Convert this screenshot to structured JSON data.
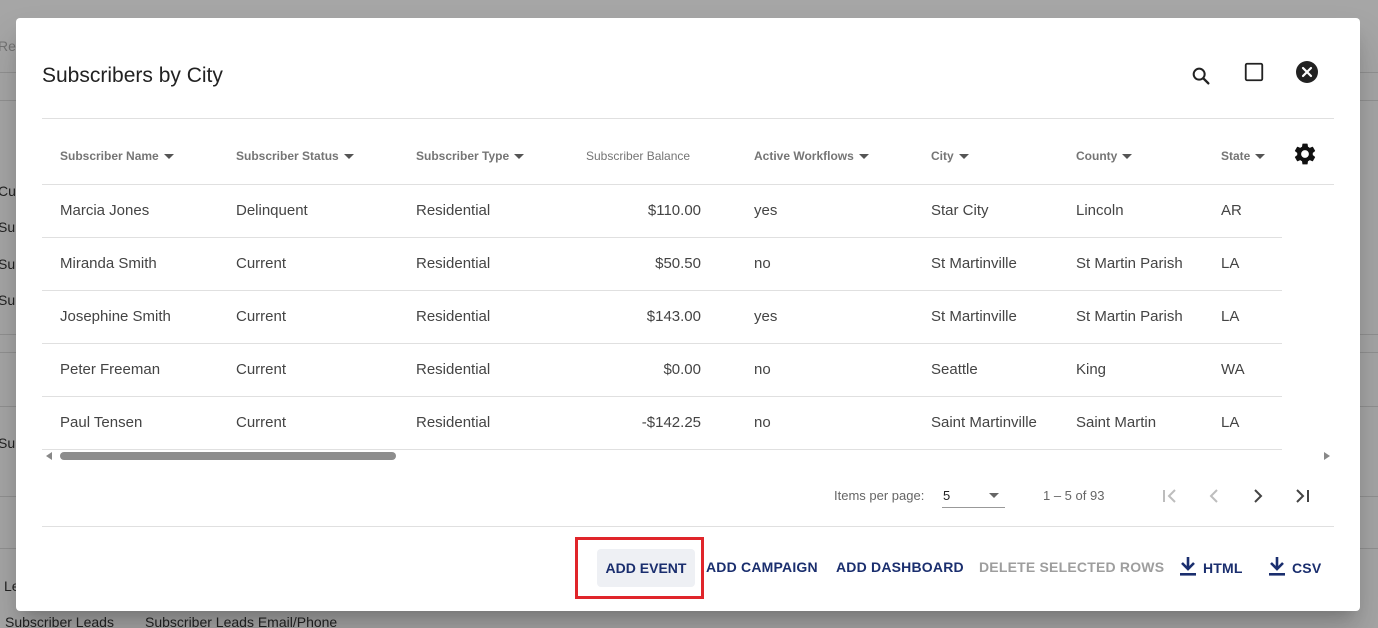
{
  "background": {
    "text_top_left": "Ref",
    "side_fragments": [
      "Cur",
      "Sub",
      "Sub",
      "Sub",
      "Sub",
      "Le"
    ],
    "bottom_tabs": [
      "Subscriber Leads",
      "Subscriber Leads Email/Phone"
    ]
  },
  "dialog": {
    "title": "Subscribers by City",
    "header_icons": [
      "search-icon",
      "maximize-icon",
      "close-circle-icon"
    ]
  },
  "table": {
    "columns": [
      {
        "label": "Subscriber Name",
        "sortable": true
      },
      {
        "label": "Subscriber Status",
        "sortable": true
      },
      {
        "label": "Subscriber Type",
        "sortable": true
      },
      {
        "label": "Subscriber Balance",
        "sortable": false
      },
      {
        "label": "Active Workflows",
        "sortable": true
      },
      {
        "label": "City",
        "sortable": true
      },
      {
        "label": "County",
        "sortable": true
      },
      {
        "label": "State",
        "sortable": true
      }
    ],
    "settings_icon": "gear-icon",
    "rows": [
      [
        "Marcia Jones",
        "Delinquent",
        "Residential",
        "$110.00",
        "yes",
        "Star City",
        "Lincoln",
        "AR"
      ],
      [
        "Miranda Smith",
        "Current",
        "Residential",
        "$50.50",
        "no",
        "St Martinville",
        "St Martin Parish",
        "LA"
      ],
      [
        "Josephine Smith",
        "Current",
        "Residential",
        "$143.00",
        "yes",
        "St Martinville",
        "St Martin Parish",
        "LA"
      ],
      [
        "Peter Freeman",
        "Current",
        "Residential",
        "$0.00",
        "no",
        "Seattle",
        "King",
        "WA"
      ],
      [
        "Paul Tensen",
        "Current",
        "Residential",
        "-$142.25",
        "no",
        "Saint Martinville",
        "Saint Martin",
        "LA"
      ]
    ]
  },
  "paginator": {
    "items_per_page_label": "Items per page:",
    "items_per_page_value": "5",
    "range_label": "1 – 5 of 93"
  },
  "actions": {
    "add_event": "ADD EVENT",
    "add_campaign": "ADD CAMPAIGN",
    "add_dashboard": "ADD DASHBOARD",
    "delete_selected_rows": "DELETE SELECTED ROWS",
    "html": "HTML",
    "csv": "CSV"
  },
  "colors": {
    "action_text": "#1a2e6e",
    "disabled_text": "#9e9e9e",
    "highlight_border": "#e0252a"
  }
}
